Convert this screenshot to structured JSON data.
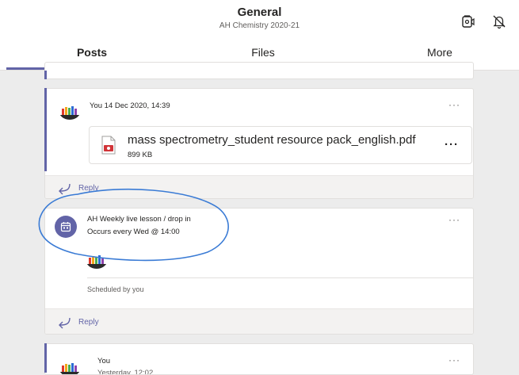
{
  "header": {
    "channel_title": "General",
    "team_name": "AH Chemistry 2020-21",
    "icons": [
      "video-camera-icon",
      "bell-off-icon"
    ]
  },
  "tabs": [
    {
      "label": "Posts",
      "active": true
    },
    {
      "label": "Files",
      "active": false
    },
    {
      "label": "More",
      "active": false
    }
  ],
  "posts": {
    "file_post": {
      "author_time": "You 14 Dec 2020, 14:39",
      "more": "···",
      "file_name": "mass spectrometry_student resource pack_english.pdf",
      "file_size": "899 KB",
      "file_more": "···",
      "reply_label": "Reply"
    },
    "meeting_post": {
      "title": "AH Weekly live lesson / drop in",
      "recurrence": "Occurs every Wed @ 14:00",
      "more": "···",
      "scheduled_by": "Scheduled by you",
      "reply_label": "Reply"
    },
    "third_post": {
      "author": "You",
      "time": "Yesterday, 12:02",
      "more": "···"
    }
  },
  "colors": {
    "accent": "#6264a7",
    "annotation_ink": "#3a7bd5",
    "background": "#ececec",
    "card": "#ffffff"
  }
}
